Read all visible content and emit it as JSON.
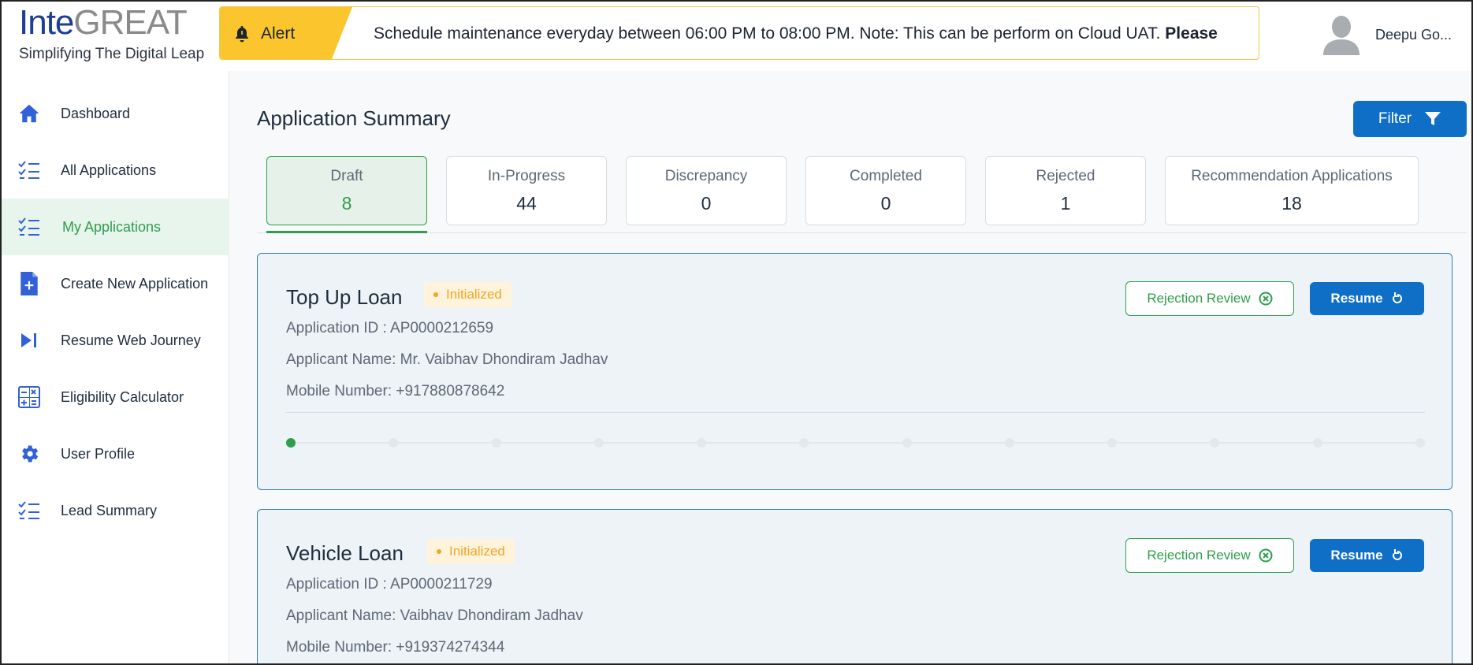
{
  "brand": {
    "logo_main_a": "Inte",
    "logo_main_b": "GREAT",
    "tagline": "Simplifying The Digital Leap"
  },
  "alert": {
    "label": "Alert",
    "message": "Schedule maintenance everyday between 06:00 PM to 08:00 PM. Note: This can be perform on Cloud UAT. ",
    "message_bold": "Please"
  },
  "user": {
    "name": "Deepu Go..."
  },
  "sidebar": {
    "items": [
      {
        "label": "Dashboard",
        "icon": "home-icon"
      },
      {
        "label": "All Applications",
        "icon": "checklist-icon"
      },
      {
        "label": "My Applications",
        "icon": "checklist-icon",
        "active": true
      },
      {
        "label": "Create New Application",
        "icon": "file-plus-icon"
      },
      {
        "label": "Resume Web Journey",
        "icon": "play-skip-icon"
      },
      {
        "label": "Eligibility Calculator",
        "icon": "calculator-icon"
      },
      {
        "label": "User Profile",
        "icon": "gear-icon"
      },
      {
        "label": "Lead Summary",
        "icon": "checklist-icon"
      }
    ]
  },
  "main": {
    "title": "Application Summary",
    "filter_label": "Filter",
    "tabs": [
      {
        "label": "Draft",
        "count": "8"
      },
      {
        "label": "In-Progress",
        "count": "44"
      },
      {
        "label": "Discrepancy",
        "count": "0"
      },
      {
        "label": "Completed",
        "count": "0"
      },
      {
        "label": "Rejected",
        "count": "1"
      },
      {
        "label": "Recommendation Applications",
        "count": "18"
      }
    ],
    "cards": [
      {
        "title": "Top Up Loan",
        "status": "Initialized",
        "application_id": "Application ID : AP0000212659",
        "applicant": "Applicant Name: Mr. Vaibhav Dhondiram Jadhav",
        "mobile": "Mobile Number: +917880878642",
        "rejection_review_label": "Rejection Review",
        "resume_label": "Resume",
        "progress_steps_total": 12,
        "progress_steps_done": 1
      },
      {
        "title": "Vehicle Loan",
        "status": "Initialized",
        "application_id": "Application ID : AP0000211729",
        "applicant": "Applicant Name: Vaibhav Dhondiram Jadhav",
        "mobile": "Mobile Number: +919374274344",
        "rejection_review_label": "Rejection Review",
        "resume_label": "Resume"
      }
    ]
  },
  "colors": {
    "primary": "#0f6fc6",
    "success": "#2e9e4e",
    "alert": "#fbc62d",
    "badge_text": "#f0a526"
  }
}
